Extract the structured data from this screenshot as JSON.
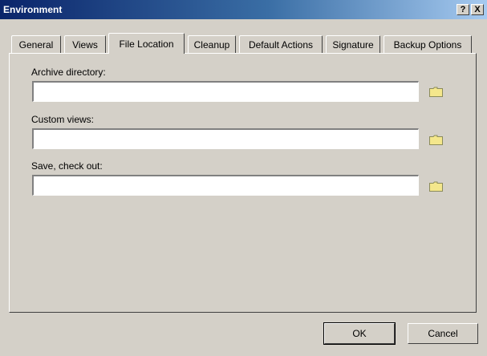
{
  "window": {
    "title": "Environment",
    "help_label": "?",
    "close_label": "X"
  },
  "tabs": [
    {
      "label": "General",
      "active": false
    },
    {
      "label": "Views",
      "active": false
    },
    {
      "label": "File Location",
      "active": true
    },
    {
      "label": "Cleanup",
      "active": false
    },
    {
      "label": "Default Actions",
      "active": false
    },
    {
      "label": "Signature",
      "active": false
    },
    {
      "label": "Backup Options",
      "active": false
    }
  ],
  "fields": [
    {
      "label": "Archive directory:",
      "value": "",
      "browse_icon": "folder-icon"
    },
    {
      "label": "Custom views:",
      "value": "",
      "browse_icon": "folder-icon"
    },
    {
      "label": "Save, check out:",
      "value": "",
      "browse_icon": "folder-icon"
    }
  ],
  "buttons": {
    "ok": "OK",
    "cancel": "Cancel"
  },
  "colors": {
    "face": "#d4d0c8",
    "titlebar_start": "#0a246a",
    "titlebar_end": "#a6caf0",
    "folder": "#f4e78c"
  }
}
